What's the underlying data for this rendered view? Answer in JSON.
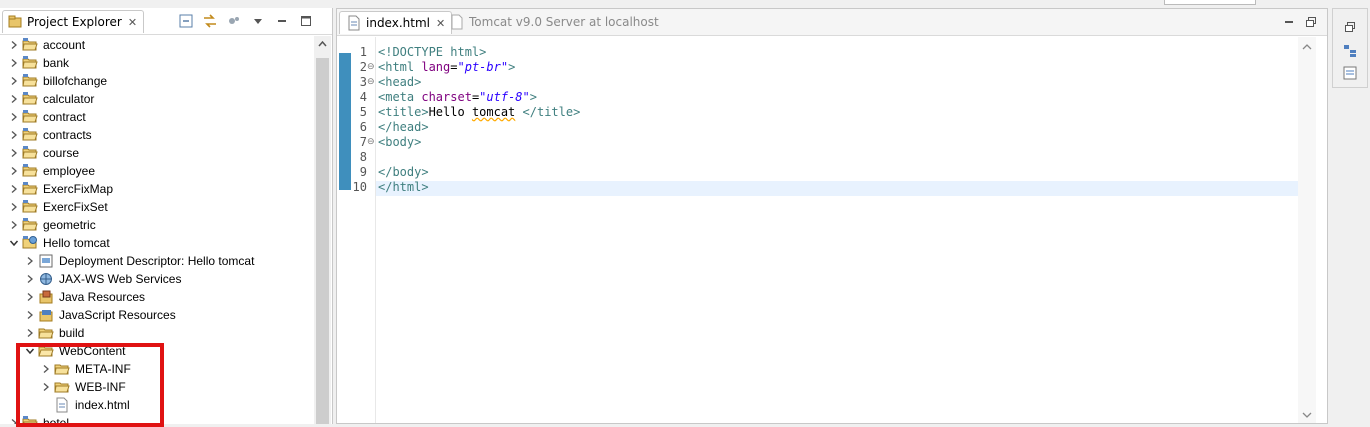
{
  "explorer": {
    "title": "Project Explorer",
    "tree": [
      {
        "label": "account",
        "level": 0,
        "expand": "collapsed",
        "icon": "project-folder-icon"
      },
      {
        "label": "bank",
        "level": 0,
        "expand": "collapsed",
        "icon": "project-folder-icon"
      },
      {
        "label": "billofchange",
        "level": 0,
        "expand": "collapsed",
        "icon": "project-folder-icon"
      },
      {
        "label": "calculator",
        "level": 0,
        "expand": "collapsed",
        "icon": "project-folder-icon"
      },
      {
        "label": "contract",
        "level": 0,
        "expand": "collapsed",
        "icon": "project-folder-icon"
      },
      {
        "label": "contracts",
        "level": 0,
        "expand": "collapsed",
        "icon": "project-folder-icon"
      },
      {
        "label": "course",
        "level": 0,
        "expand": "collapsed",
        "icon": "project-folder-icon"
      },
      {
        "label": "employee",
        "level": 0,
        "expand": "collapsed",
        "icon": "project-folder-icon"
      },
      {
        "label": "ExercFixMap",
        "level": 0,
        "expand": "collapsed",
        "icon": "project-folder-icon"
      },
      {
        "label": "ExercFixSet",
        "level": 0,
        "expand": "collapsed",
        "icon": "project-folder-icon"
      },
      {
        "label": "geometric",
        "level": 0,
        "expand": "collapsed",
        "icon": "project-folder-icon"
      },
      {
        "label": "Hello tomcat",
        "level": 0,
        "expand": "expanded",
        "icon": "web-project-icon"
      },
      {
        "label": "Deployment Descriptor: Hello tomcat",
        "level": 1,
        "expand": "collapsed",
        "icon": "deployment-descriptor-icon"
      },
      {
        "label": "JAX-WS Web Services",
        "level": 1,
        "expand": "collapsed",
        "icon": "web-services-icon"
      },
      {
        "label": "Java Resources",
        "level": 1,
        "expand": "collapsed",
        "icon": "java-resources-icon"
      },
      {
        "label": "JavaScript Resources",
        "level": 1,
        "expand": "collapsed",
        "icon": "javascript-resources-icon"
      },
      {
        "label": "build",
        "level": 1,
        "expand": "collapsed",
        "icon": "folder-icon"
      },
      {
        "label": "WebContent",
        "level": 1,
        "expand": "expanded",
        "icon": "folder-open-icon"
      },
      {
        "label": "META-INF",
        "level": 2,
        "expand": "collapsed",
        "icon": "folder-icon"
      },
      {
        "label": "WEB-INF",
        "level": 2,
        "expand": "collapsed",
        "icon": "folder-icon"
      },
      {
        "label": "index.html",
        "level": 2,
        "expand": "none",
        "icon": "html-file-icon"
      },
      {
        "label": "hotel",
        "level": 0,
        "expand": "collapsed",
        "icon": "project-folder-icon"
      }
    ]
  },
  "editor": {
    "tabs": [
      {
        "label": "index.html",
        "active": true
      },
      {
        "label": "Tomcat v9.0 Server at localhost",
        "active": false
      }
    ],
    "lines": [
      {
        "n": "1",
        "fold": "",
        "tokens": [
          [
            "tag",
            "<!DOCTYPE html>"
          ]
        ]
      },
      {
        "n": "2",
        "fold": "⊖",
        "tokens": [
          [
            "tag",
            "<html "
          ],
          [
            "attr",
            "lang"
          ],
          [
            "txt",
            "="
          ],
          [
            "val",
            "\"pt-br\""
          ],
          [
            "tag",
            ">"
          ]
        ]
      },
      {
        "n": "3",
        "fold": "⊖",
        "tokens": [
          [
            "tag",
            "<head>"
          ]
        ]
      },
      {
        "n": "4",
        "fold": "",
        "tokens": [
          [
            "tag",
            "<meta "
          ],
          [
            "attr",
            "charset"
          ],
          [
            "txt",
            "="
          ],
          [
            "val",
            "\"utf-8\""
          ],
          [
            "tag",
            ">"
          ]
        ]
      },
      {
        "n": "5",
        "fold": "",
        "tokens": [
          [
            "tag",
            "<title>"
          ],
          [
            "txt",
            "Hello "
          ],
          [
            "spell",
            "tomcat"
          ],
          [
            "txt",
            " "
          ],
          [
            "tag",
            "</title>"
          ]
        ]
      },
      {
        "n": "6",
        "fold": "",
        "tokens": [
          [
            "tag",
            "</head>"
          ]
        ]
      },
      {
        "n": "7",
        "fold": "⊖",
        "tokens": [
          [
            "tag",
            "<body>"
          ]
        ]
      },
      {
        "n": "8",
        "fold": "",
        "tokens": []
      },
      {
        "n": "9",
        "fold": "",
        "tokens": [
          [
            "tag",
            "</body>"
          ]
        ]
      },
      {
        "n": "10",
        "fold": "",
        "tokens": [
          [
            "tag",
            "</html>"
          ]
        ]
      }
    ]
  },
  "colors": {
    "accent": "#3f8fbd",
    "highlight": "#e01212",
    "tag": "#3f7f7f",
    "attr": "#7f007f",
    "value": "#2a00ff"
  }
}
